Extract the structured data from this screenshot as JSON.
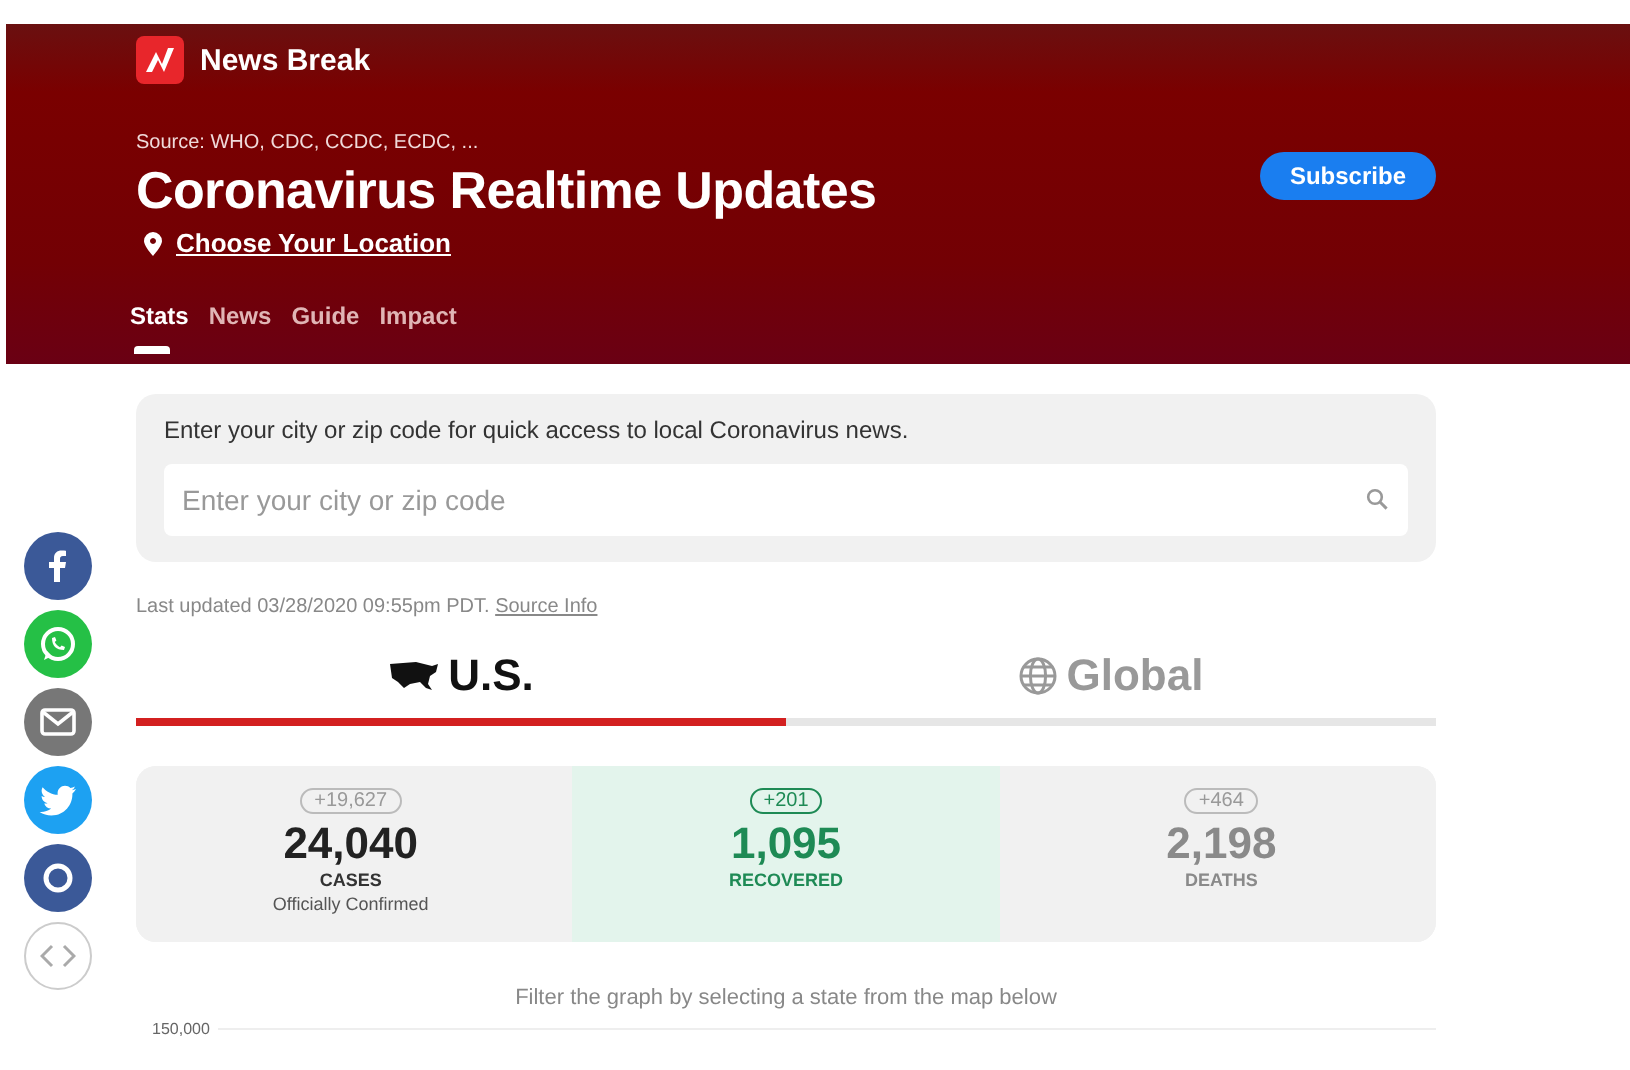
{
  "brand": {
    "name": "News Break"
  },
  "header": {
    "source": "Source: WHO, CDC, CCDC, ECDC, ...",
    "title": "Coronavirus Realtime Updates",
    "location_link": "Choose Your Location",
    "subscribe_button": "Subscribe"
  },
  "nav_tabs": [
    {
      "label": "Stats",
      "selected": true
    },
    {
      "label": "News",
      "selected": false
    },
    {
      "label": "Guide",
      "selected": false
    },
    {
      "label": "Impact",
      "selected": false
    }
  ],
  "location_box": {
    "prompt": "Enter your city or zip code for quick access to local Coronavirus news.",
    "placeholder": "Enter your city or zip code"
  },
  "last_updated": "Last updated 03/28/2020 09:55pm PDT.",
  "source_link": "Source Info",
  "region_tabs": [
    {
      "label": "U.S.",
      "kind": "us",
      "selected": true
    },
    {
      "label": "Global",
      "kind": "globe",
      "selected": false
    }
  ],
  "stats": [
    {
      "kind": "cases",
      "change": "+19,627",
      "value": "24,040",
      "label": "CASES",
      "note": "Officially Confirmed"
    },
    {
      "kind": "recovered",
      "change": "+201",
      "value": "1,095",
      "label": "RECOVERED"
    },
    {
      "kind": "deaths",
      "change": "+464",
      "value": "2,198",
      "label": "DEATHS"
    }
  ],
  "share_buttons": [
    {
      "kind": "facebook"
    },
    {
      "kind": "whatsapp"
    },
    {
      "kind": "email"
    },
    {
      "kind": "twitter"
    },
    {
      "kind": "other"
    },
    {
      "kind": "embed"
    }
  ],
  "graph_hint": "Filter the graph by selecting a state from the map below",
  "graph_axis_label": "150,000"
}
